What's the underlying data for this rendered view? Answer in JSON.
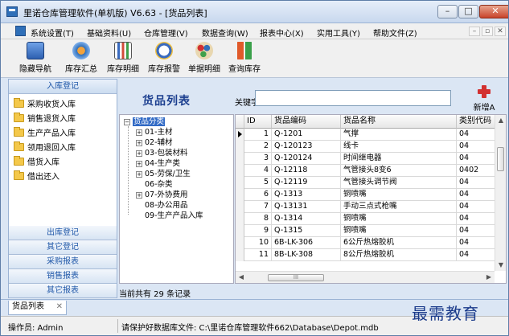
{
  "window": {
    "title": "里诺仓库管理软件(单机版) V6.63 - [货品列表]",
    "controls": {
      "minimize": "–",
      "maximize": "□",
      "close": "✕"
    }
  },
  "menubar": {
    "items": [
      "系统设置(T)",
      "基础资料(U)",
      "仓库管理(V)",
      "数据查询(W)",
      "报表中心(X)",
      "实用工具(Y)",
      "帮助文件(Z)"
    ],
    "mdi": [
      "–",
      "▫",
      "✕"
    ]
  },
  "toolbar": {
    "buttons": [
      {
        "label": "隐藏导航",
        "icon": "monitor-icon"
      },
      {
        "label": "库存汇总",
        "icon": "disk-icon"
      },
      {
        "label": "库存明细",
        "icon": "bar-chart-icon"
      },
      {
        "label": "库存报警",
        "icon": "alarm-clock-icon"
      },
      {
        "label": "单据明细",
        "icon": "palette-icon"
      },
      {
        "label": "查询库存",
        "icon": "bottles-icon"
      }
    ]
  },
  "sidebar": {
    "top_header": "入库登记",
    "items": [
      "采购收货入库",
      "销售退货入库",
      "生产产品入库",
      "领用退回入库",
      "借货入库",
      "借出还入"
    ],
    "bottom_headers": [
      "出库登记",
      "其它登记",
      "采购报表",
      "销售报表",
      "其它报表"
    ]
  },
  "content": {
    "title": "货品列表",
    "keyword_label": "关键字",
    "keyword_value": "",
    "add_button": "新增A"
  },
  "tree": {
    "root": "货品分类",
    "nodes": [
      "01-主材",
      "02-辅材",
      "03-包装材料",
      "04-生产类",
      "05-劳保/卫生",
      "06-杂类",
      "07-外协费用",
      "08-办公用品",
      "09-生产产品入库"
    ],
    "expandable": [
      true,
      true,
      true,
      true,
      true,
      false,
      true,
      false,
      false
    ]
  },
  "grid": {
    "columns": [
      "ID",
      "货品编码",
      "货品名称",
      "类别代码"
    ],
    "rows": [
      [
        "1",
        "Q-1201",
        "气撑",
        "04"
      ],
      [
        "2",
        "Q-120123",
        "线卡",
        "04"
      ],
      [
        "3",
        "Q-120124",
        "时间继电器",
        "04"
      ],
      [
        "4",
        "Q-12118",
        "气管接头8变6",
        "0402"
      ],
      [
        "5",
        "Q-12119",
        "气管接头调节阀",
        "04"
      ],
      [
        "6",
        "Q-1313",
        "铜喷嘴",
        "04"
      ],
      [
        "7",
        "Q-13131",
        "手动三点式枪嘴",
        "04"
      ],
      [
        "8",
        "Q-1314",
        "铜喷嘴",
        "04"
      ],
      [
        "9",
        "Q-1315",
        "铜喷嘴",
        "04"
      ],
      [
        "10",
        "6B-LK-306",
        "6公斤热熔胶机",
        "04"
      ],
      [
        "11",
        "8B-LK-308",
        "8公斤热熔胶机",
        "04"
      ]
    ],
    "selected_row": 0,
    "hscroll_thumb": "III"
  },
  "record_count": "当前共有 29 条记录",
  "tabs": [
    {
      "label": "货品列表",
      "close": "✕"
    }
  ],
  "status": {
    "operator": "操作员: Admin",
    "db_path": "请保护好数据库文件: C:\\里诺仓库管理软件662\\Database\\Depot.mdb"
  },
  "watermark": "最需教育"
}
